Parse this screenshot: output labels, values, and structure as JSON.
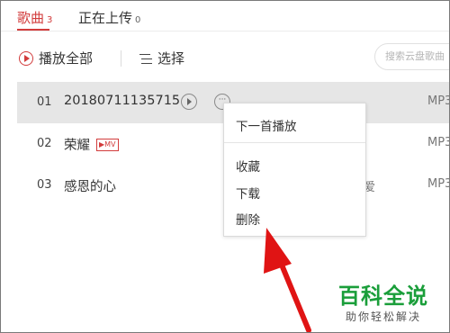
{
  "tabs": [
    {
      "label": "歌曲",
      "count": "3"
    },
    {
      "label": "正在上传",
      "count": "0"
    }
  ],
  "toolbar": {
    "play_all_label": "播放全部",
    "select_label": "选择",
    "search_placeholder": "搜索云盘歌曲"
  },
  "songs": [
    {
      "num": "01",
      "name": "20180711135715",
      "format": "MP3"
    },
    {
      "num": "02",
      "name": "荣耀",
      "badge": "MV",
      "format": "MP3"
    },
    {
      "num": "03",
      "name": "感恩的心",
      "artist": "的爱",
      "format": "MP3"
    }
  ],
  "context_menu": {
    "items": [
      "下一首播放",
      "收藏",
      "下载",
      "删除"
    ]
  },
  "watermark": {
    "main": "百科全说",
    "sub": "助你轻松解决"
  },
  "colors": {
    "accent": "#d23c3c",
    "arrow": "#e01414",
    "watermark": "#1a9e3a"
  }
}
